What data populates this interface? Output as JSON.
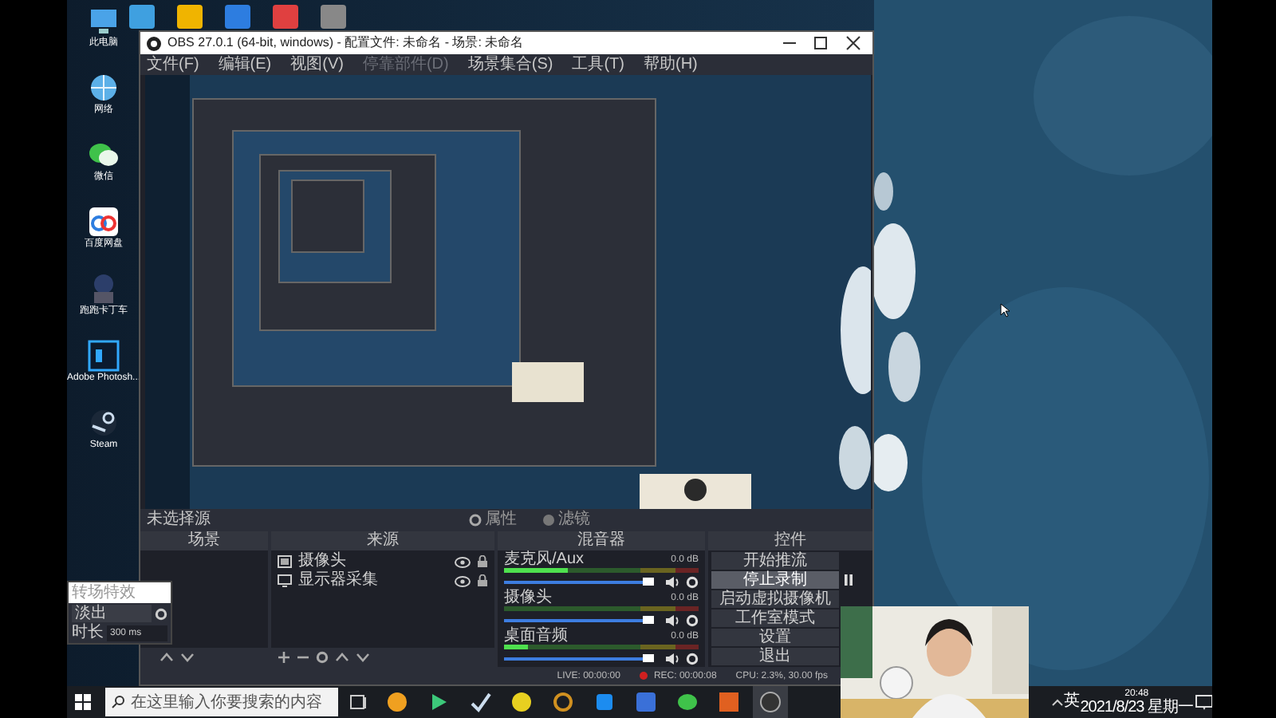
{
  "desktop_icons": [
    {
      "label": "此电脑"
    },
    {
      "label": "网络"
    },
    {
      "label": "微信"
    },
    {
      "label": "百度网盘"
    },
    {
      "label": "跑跑卡丁车"
    },
    {
      "label": "Adobe Photosh..."
    },
    {
      "label": "Steam"
    }
  ],
  "obs_window": {
    "title": "OBS 27.0.1 (64-bit, windows) - 配置文件: 未命名 - 场景: 未命名",
    "menu": [
      {
        "label": "文件(F)",
        "disabled": false
      },
      {
        "label": "编辑(E)",
        "disabled": false
      },
      {
        "label": "视图(V)",
        "disabled": false
      },
      {
        "label": "停靠部件(D)",
        "disabled": true
      },
      {
        "label": "场景集合(S)",
        "disabled": false
      },
      {
        "label": "工具(T)",
        "disabled": false
      },
      {
        "label": "帮助(H)",
        "disabled": false
      }
    ],
    "source_status": "未选择源",
    "source_buttons": [
      "属性",
      "滤镜"
    ],
    "docks": {
      "scenes": {
        "title": "场景"
      },
      "sources": {
        "title": "来源",
        "items": [
          {
            "label": "摄像头"
          },
          {
            "label": "显示器采集"
          }
        ]
      },
      "mixer": {
        "title": "混音器",
        "tracks": [
          {
            "name": "麦克风/Aux",
            "reading": "0.0 dB",
            "meter": {
              "level": 0.33
            },
            "fader": {
              "level": 0.97
            }
          },
          {
            "name": "摄像头",
            "reading": "0.0 dB",
            "meter": {
              "level": 0.0
            },
            "fader": {
              "level": 0.97
            }
          },
          {
            "name": "桌面音频",
            "reading": "0.0 dB",
            "meter": {
              "level": 0.12
            },
            "fader": {
              "level": 0.97
            }
          }
        ]
      },
      "controls": {
        "title": "控件",
        "buttons": [
          {
            "label": "开始推流",
            "selected": false
          },
          {
            "label": "停止录制",
            "selected": true
          },
          {
            "label": "启动虚拟摄像机",
            "selected": false
          },
          {
            "label": "工作室模式",
            "selected": false
          },
          {
            "label": "设置",
            "selected": false
          },
          {
            "label": "退出",
            "selected": false
          }
        ]
      }
    },
    "status_bar": {
      "live": "LIVE: 00:00:00",
      "rec": "REC: 00:00:08",
      "cpu": "CPU: 2.3%, 30.00 fps"
    }
  },
  "transition_panel": {
    "name_field": "转场特效",
    "transition": "淡出",
    "duration_label": "时长",
    "duration": "300 ms"
  },
  "taskbar": {
    "search_placeholder": "在这里输入你要搜索的内容",
    "input_method": "英",
    "time": "20:48",
    "date": "2021/8/23 星期一"
  }
}
